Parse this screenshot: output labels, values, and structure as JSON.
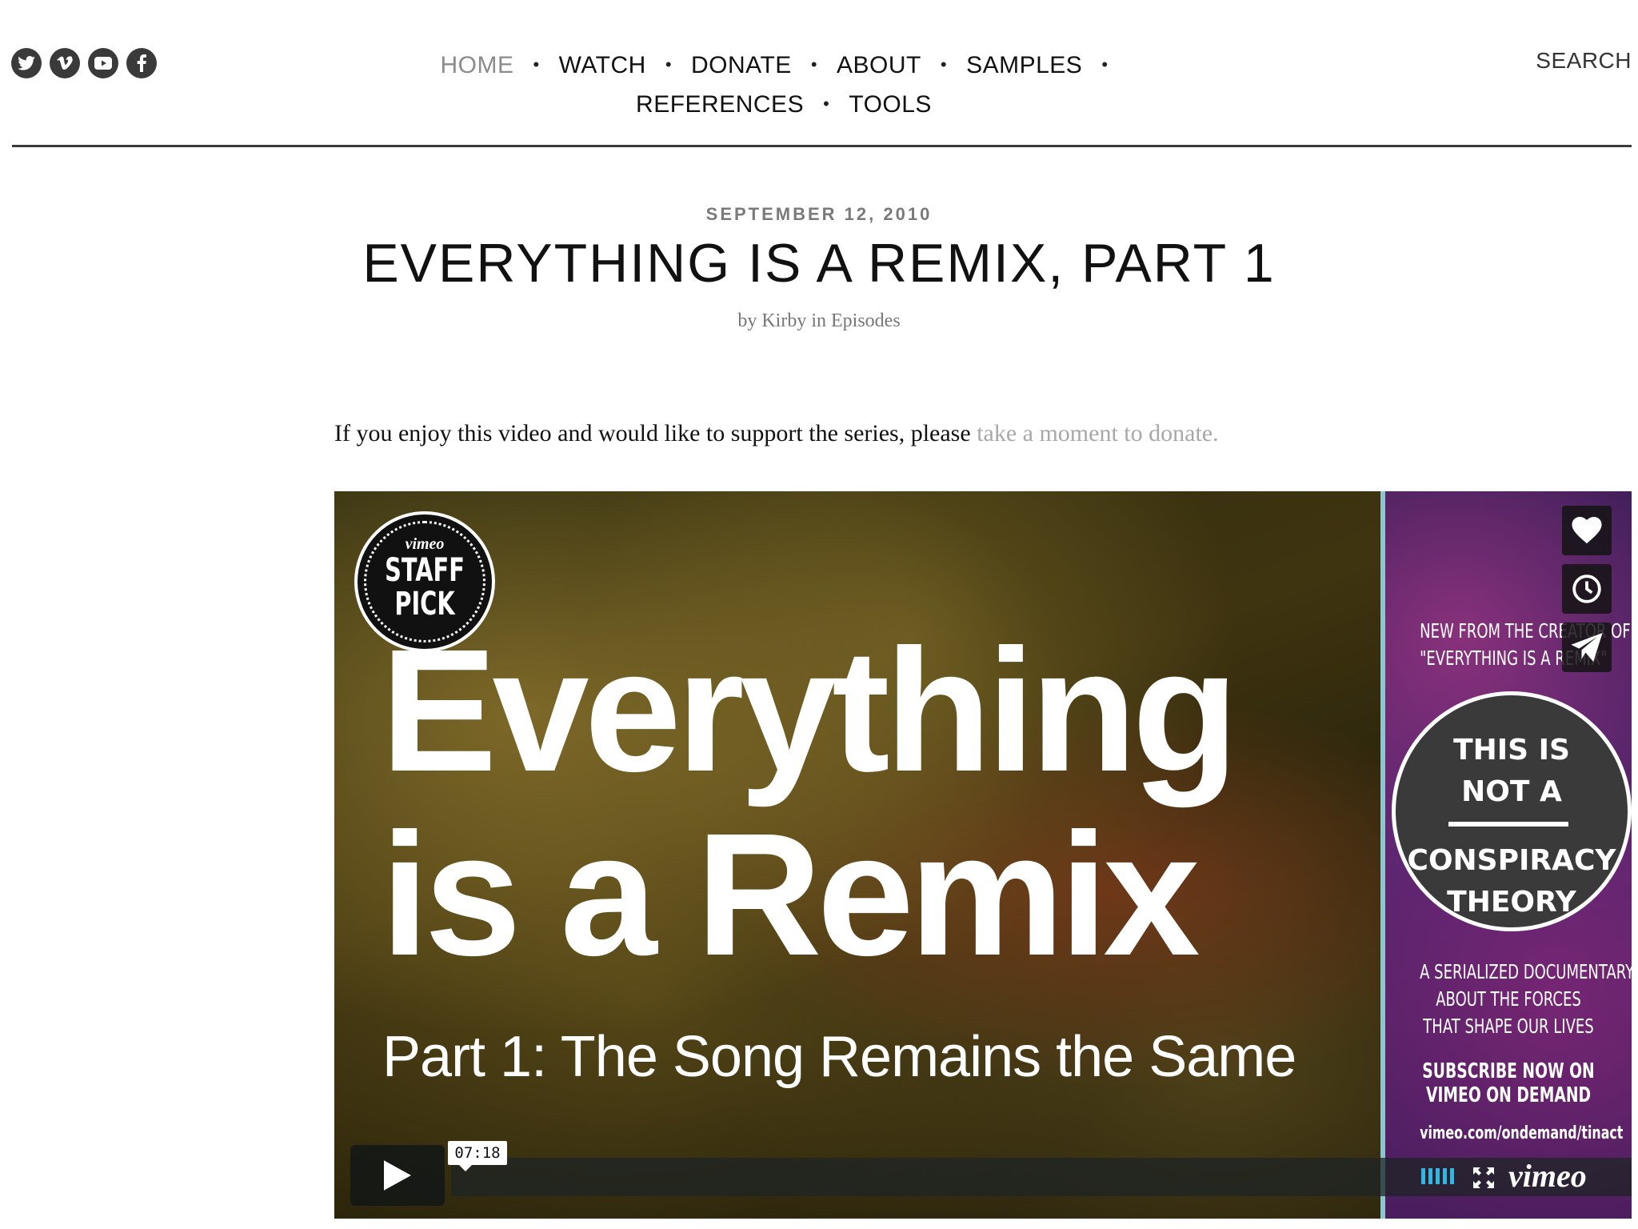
{
  "social": {
    "icons": [
      "twitter-icon",
      "vimeo-icon",
      "youtube-icon",
      "facebook-icon"
    ],
    "color": "#3a3a3a"
  },
  "nav": {
    "items": [
      {
        "label": "HOME",
        "current": true
      },
      {
        "label": "WATCH"
      },
      {
        "label": "DONATE"
      },
      {
        "label": "ABOUT"
      },
      {
        "label": "SAMPLES"
      },
      {
        "label": "REFERENCES"
      },
      {
        "label": "TOOLS"
      }
    ],
    "separator": "•",
    "current_color": "#8c8c8c"
  },
  "search": {
    "label": "SEARCH"
  },
  "post": {
    "date": "SEPTEMBER 12, 2010",
    "title": "EVERYTHING IS A REMIX, PART 1",
    "meta_by": "by ",
    "author": "Kirby",
    "meta_in": " in ",
    "category": "Episodes"
  },
  "intro": {
    "text": "If you enjoy this video and would like to support the series, please ",
    "link": "take a moment to donate."
  },
  "video": {
    "badge_top": "vimeo",
    "badge_line1": "STAFF",
    "badge_line2": "PICK",
    "title_line1": "Everything",
    "title_line2": "is a Remix",
    "subtitle": "Part 1: The Song Remains the Same",
    "duration": "07:18",
    "brand": "vimeo",
    "hd_color": "#33b6e0"
  },
  "promo": {
    "line1": "NEW FROM THE CREATOR OF",
    "line2": "\"EVERYTHING IS A REMIX\"",
    "circle_line1": "THIS IS",
    "circle_line2": "NOT A",
    "circle_line3": "CONSPIRACY",
    "circle_line4": "THEORY",
    "desc1": "A SERIALIZED DOCUMENTARY",
    "desc2": "ABOUT THE FORCES",
    "desc3": "THAT SHAPE OUR LIVES",
    "cta1": "SUBSCRIBE NOW ON",
    "cta2": "VIMEO ON DEMAND",
    "url": "vimeo.com/ondemand/tinact"
  }
}
